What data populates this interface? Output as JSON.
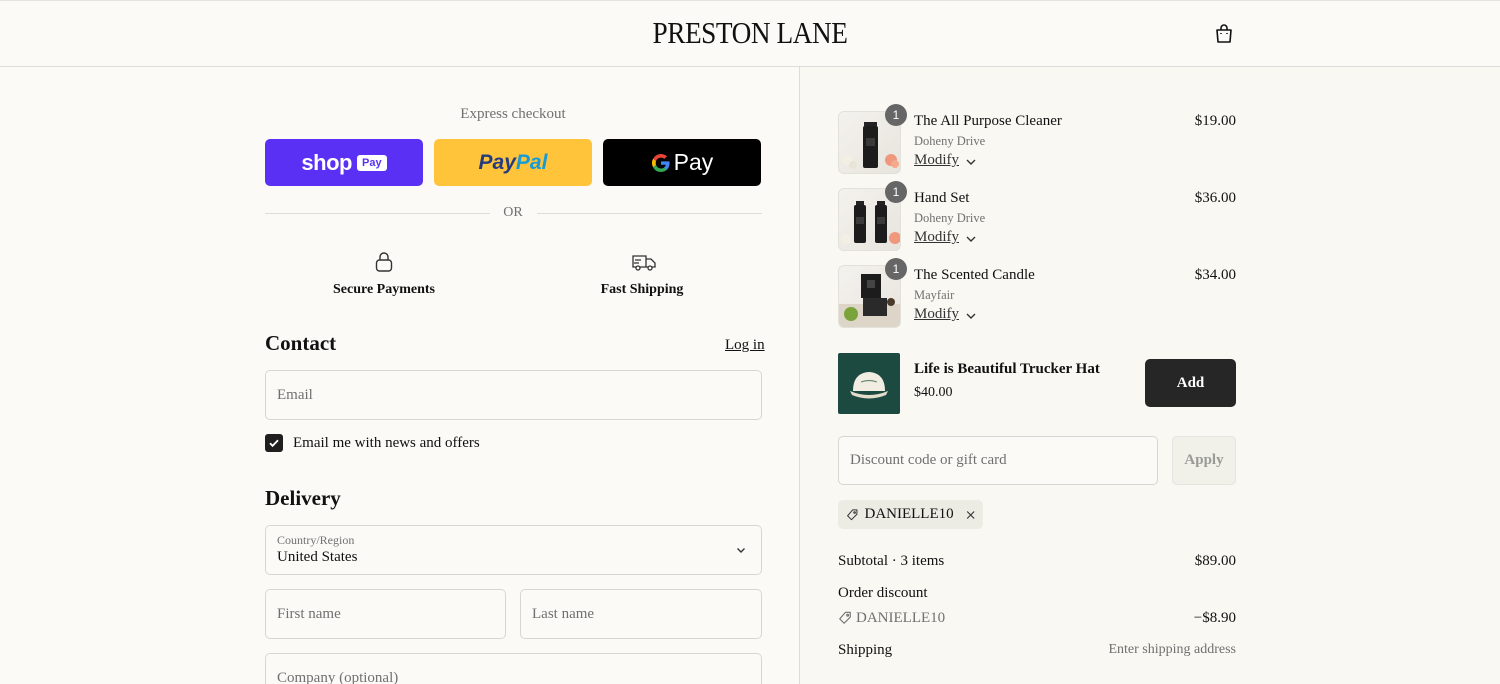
{
  "header": {
    "logo": "PRESTON LANE",
    "cart_icon": "shopping-bag-icon"
  },
  "express": {
    "label": "Express checkout",
    "shop_pay": {
      "text": "shop",
      "badge": "Pay"
    },
    "paypal": {
      "part1": "Pay",
      "part2": "Pal"
    },
    "google_pay": {
      "text": "Pay"
    },
    "or_label": "OR"
  },
  "badges": [
    {
      "icon": "lock-icon",
      "label": "Secure Payments"
    },
    {
      "icon": "truck-icon",
      "label": "Fast Shipping"
    }
  ],
  "contact": {
    "title": "Contact",
    "login_link": "Log in",
    "email_placeholder": "Email",
    "newsletter_label": "Email me with news and offers",
    "newsletter_checked": true
  },
  "delivery": {
    "title": "Delivery",
    "country_label": "Country/Region",
    "country_value": "United States",
    "first_name_placeholder": "First name",
    "last_name_placeholder": "Last name",
    "company_placeholder": "Company (optional)"
  },
  "cart": {
    "items": [
      {
        "name": "The All Purpose Cleaner",
        "variant": "Doheny Drive",
        "modify": "Modify",
        "price": "$19.00",
        "qty": "1"
      },
      {
        "name": "Hand Set",
        "variant": "Doheny Drive",
        "modify": "Modify",
        "price": "$36.00",
        "qty": "1"
      },
      {
        "name": "The Scented Candle",
        "variant": "Mayfair",
        "modify": "Modify",
        "price": "$34.00",
        "qty": "1"
      }
    ],
    "upsell": {
      "name": "Life is Beautiful Trucker Hat",
      "price": "$40.00",
      "button": "Add"
    },
    "discount_placeholder": "Discount code or gift card",
    "apply_label": "Apply",
    "applied_code": "DANIELLE10"
  },
  "summary": {
    "subtotal_label": "Subtotal · 3 items",
    "subtotal_value": "$89.00",
    "discount_label": "Order discount",
    "discount_code": "DANIELLE10",
    "discount_value": "−$8.90",
    "shipping_label": "Shipping",
    "shipping_value": "Enter shipping address"
  }
}
